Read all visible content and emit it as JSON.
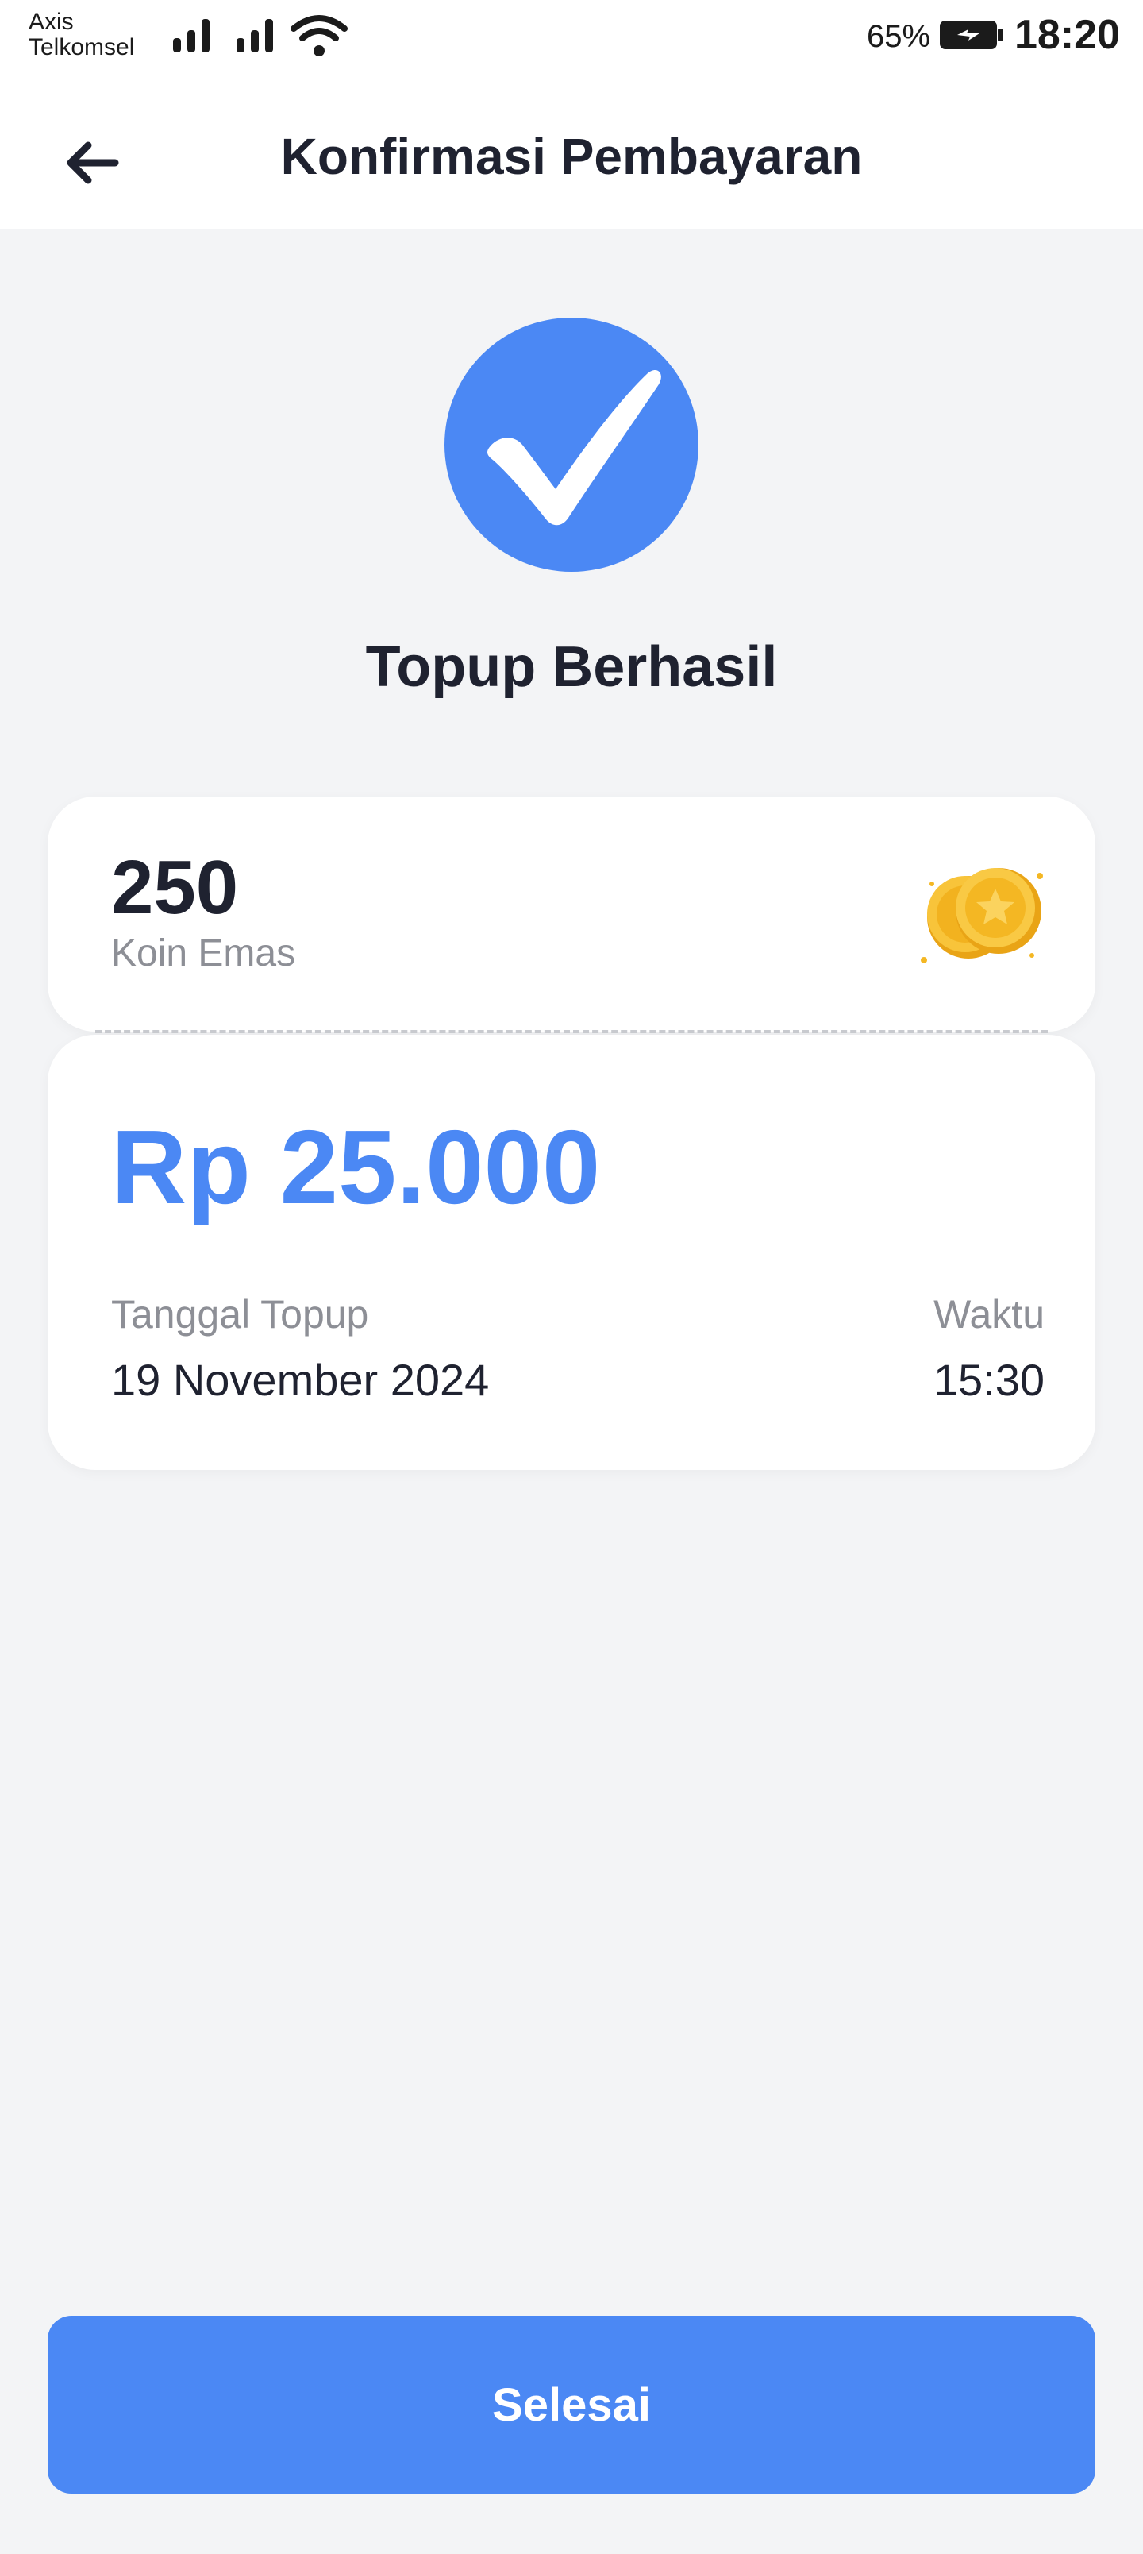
{
  "status_bar": {
    "carrier_line1": "Axis",
    "carrier_line2": "Telkomsel",
    "battery_percent": "65%",
    "time": "18:20",
    "icons": [
      "signal-icon",
      "signal-icon",
      "wifi-icon",
      "battery-charging-icon"
    ]
  },
  "header": {
    "title": "Konfirmasi Pembayaran",
    "back_icon": "arrow-left-icon"
  },
  "success": {
    "icon": "check-circle-icon",
    "title": "Topup Berhasil"
  },
  "coin_card": {
    "amount": "250",
    "label": "Koin Emas",
    "icon": "gold-coins-icon"
  },
  "payment_card": {
    "price": "Rp 25.000",
    "date_label": "Tanggal Topup",
    "date_value": "19 November 2024",
    "time_label": "Waktu",
    "time_value": "15:30"
  },
  "footer": {
    "done_label": "Selesai"
  },
  "colors": {
    "accent": "#4b88f4",
    "background": "#f3f4f6",
    "card": "#ffffff",
    "text_primary": "#1f2230",
    "text_secondary": "#8d8f96",
    "coin": "#f5b825"
  }
}
